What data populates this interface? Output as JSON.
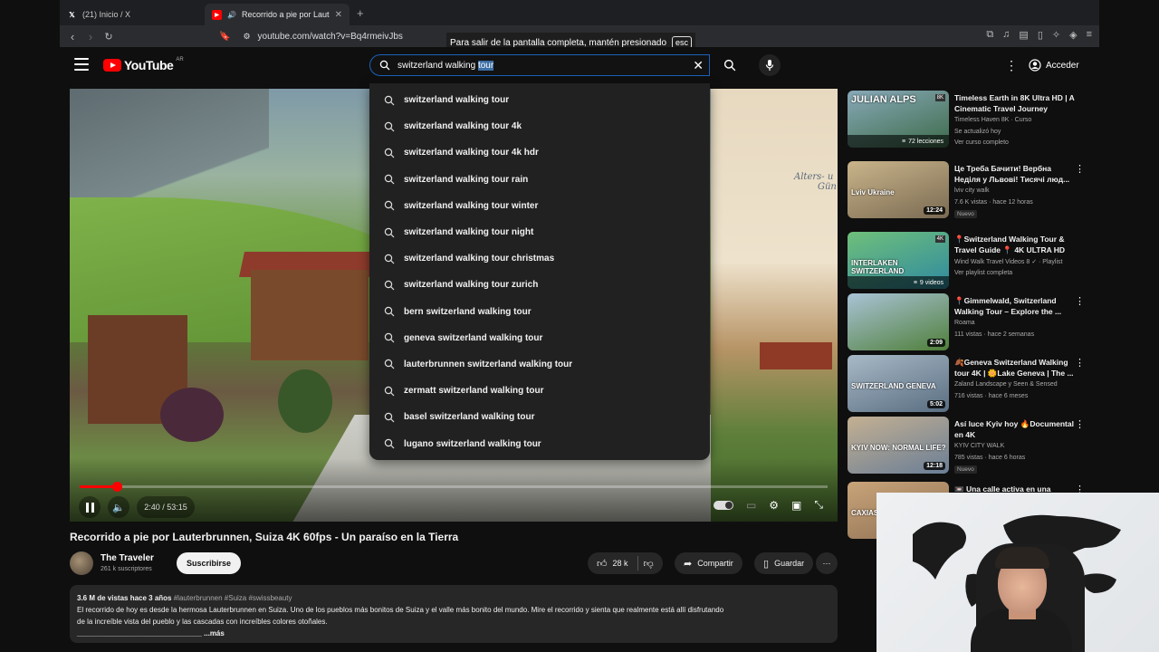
{
  "browser": {
    "tabs": [
      {
        "label": "(21) Inicio / X",
        "icon": "x-logo-icon"
      },
      {
        "label": "Recorrido a pie por Lauterb",
        "icon": "youtube-favicon-icon",
        "active": true
      }
    ],
    "url": "youtube.com/watch?v=Bq4rmeivJbs",
    "fullscreen_notice": "Para salir de la pantalla completa, mantén presionado",
    "esc_key": "esc"
  },
  "header": {
    "logo_text": "YouTube",
    "country_code": "AR",
    "search_typed": "switzerland walking ",
    "search_highlighted": "tour",
    "signin_label": "Acceder"
  },
  "suggestions": [
    {
      "prefix": "",
      "rest": "switzerland walking tour"
    },
    {
      "prefix": "",
      "rest": "switzerland walking tour 4k"
    },
    {
      "prefix": "",
      "rest": "switzerland walking tour 4k hdr"
    },
    {
      "prefix": "",
      "rest": "switzerland walking tour rain"
    },
    {
      "prefix": "",
      "rest": "switzerland walking tour winter"
    },
    {
      "prefix": "",
      "rest": "switzerland walking tour night"
    },
    {
      "prefix": "",
      "rest": "switzerland walking tour christmas"
    },
    {
      "prefix": "",
      "rest": "switzerland walking tour zurich"
    },
    {
      "prefix": "bern",
      "rest": "switzerland walking tour"
    },
    {
      "prefix": "geneva",
      "rest": "switzerland walking tour"
    },
    {
      "prefix": "lauterbrunnen",
      "rest": "switzerland walking tour"
    },
    {
      "prefix": "zermatt",
      "rest": "switzerland walking tour"
    },
    {
      "prefix": "basel",
      "rest": "switzerland walking tour"
    },
    {
      "prefix": "lugano",
      "rest": "switzerland walking tour"
    }
  ],
  "player": {
    "time": "2:40 / 53:15",
    "progress_fraction": 0.05,
    "sign_text_1": "Alters- u",
    "sign_text_2": "Gün"
  },
  "video": {
    "title": "Recorrido a pie por Lauterbrunnen, Suiza 4K 60fps - Un paraíso en la Tierra",
    "channel": "The Traveler",
    "subscribers": "261 k suscriptores",
    "subscribe_label": "Suscribirse",
    "likes": "28 k",
    "share_label": "Compartir",
    "save_label": "Guardar",
    "desc_meta": "3.6 M de vistas  hace 3 años",
    "desc_tags": "#lauterbrunnen #Suiza #swissbeauty",
    "desc_line1": "El recorrido de hoy es desde la hermosa Lauterbrunnen en Suiza. Uno de los pueblos más bonitos de Suiza y el valle más bonito del mundo. Mire el recorrido y sienta que realmente está allí disfrutando",
    "desc_line2": "de la increíble vista del pueblo y las cascadas con increíbles colores otoñales.",
    "desc_line3": "_______________________________ ...más"
  },
  "sidebar": [
    {
      "title": "Timeless Earth in 8K Ultra HD | A Cinematic Travel Journey",
      "channel": "Timeless Haven 8K · Curso",
      "meta": "Se actualizó hoy",
      "meta2": "Ver curso completo",
      "badge": "72 lecciones",
      "overlay": "JULIAN ALPS",
      "corner": "8K",
      "colors": [
        "#3d6b4a",
        "#88a9b8"
      ]
    },
    {
      "title": "Це Треба Бачити! Вербна Неділя у Львові! Тисячі люд...",
      "channel": "lviv city walk",
      "meta": "7.6 K vistas · hace 12 horas",
      "tag": "Nuevo",
      "duration": "12:24",
      "overlay": "Lviv Ukraine",
      "colors": [
        "#7a6a52",
        "#c9b48a"
      ]
    },
    {
      "title": "📍Switzerland Walking Tour & Travel Guide 📍 4K ULTRA HD",
      "channel": "Wind Walk Travel Videos 8 ✓ · Playlist",
      "meta": "Ver playlist completa",
      "badge": "9 videos",
      "overlay": "INTERLAKEN SWITZERLAND",
      "corner": "4K",
      "colors": [
        "#2f8aa0",
        "#6fbf7a"
      ]
    },
    {
      "title": "📍Gimmelwald, Switzerland Walking Tour – Explore the ...",
      "channel": "Roama",
      "meta": "111 vistas · hace 2 semanas",
      "duration": "2:09",
      "colors": [
        "#4f7f3a",
        "#a9c3d6"
      ]
    },
    {
      "title": "🍂Geneva Switzerland Walking tour 4K | 🌼Lake Geneva | The ...",
      "channel": "Zaland Landscape y Seen & Sensed",
      "meta": "716 vistas · hace 6 meses",
      "duration": "5:02",
      "overlay": "SWITZERLAND GENEVA",
      "colors": [
        "#5a6e82",
        "#a8b9c6"
      ]
    },
    {
      "title": "Así luce Kyiv hoy 🔥Documental en 4K",
      "channel": "KYIV CITY WALK",
      "meta": "785 vistas · hace 6 horas",
      "tag": "Nuevo",
      "duration": "12:18",
      "overlay": "KYIV NOW: NORMAL LIFE?",
      "colors": [
        "#6a7e96",
        "#c4b092"
      ]
    },
    {
      "title": "📼 Una calle activa en una",
      "channel": "",
      "meta": "",
      "overlay": "CAXIAS DO SUL",
      "colors": [
        "#8c6f52",
        "#c9a47a"
      ]
    }
  ],
  "colors": {
    "accent_red": "#ff0000",
    "search_border": "#1c62b9",
    "bg": "#0f0f0f",
    "surface": "#272727"
  }
}
